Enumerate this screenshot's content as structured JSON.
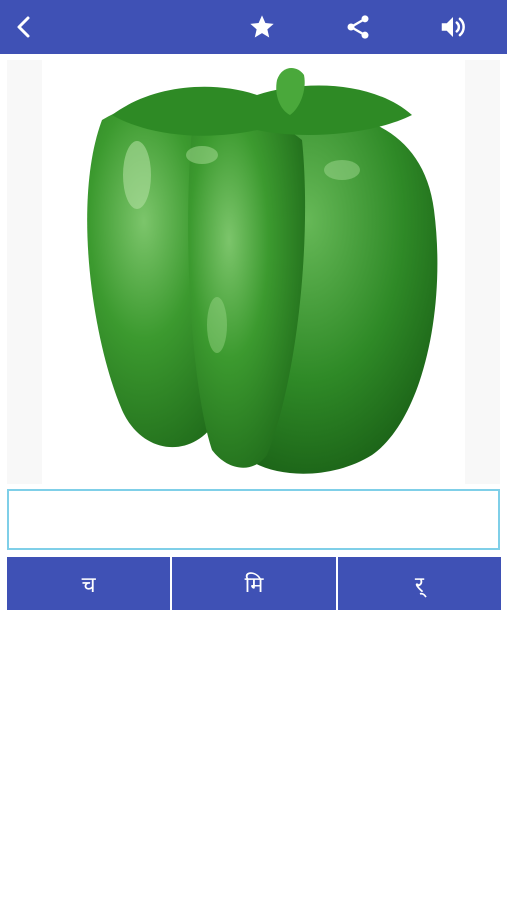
{
  "toolbar": {
    "back_icon": "chevron-left-icon",
    "favorite_icon": "star-icon",
    "share_icon": "share-icon",
    "sound_icon": "volume-icon",
    "background": "#3f51b5"
  },
  "content": {
    "image_subject": "green-bell-pepper",
    "answer_value": ""
  },
  "letter_buttons": [
    {
      "label": "च"
    },
    {
      "label": "मि"
    },
    {
      "label": "र्"
    }
  ],
  "colors": {
    "accent": "#3f51b5",
    "input_border": "#7fcfe8",
    "pepper": "#3f9a2e"
  }
}
